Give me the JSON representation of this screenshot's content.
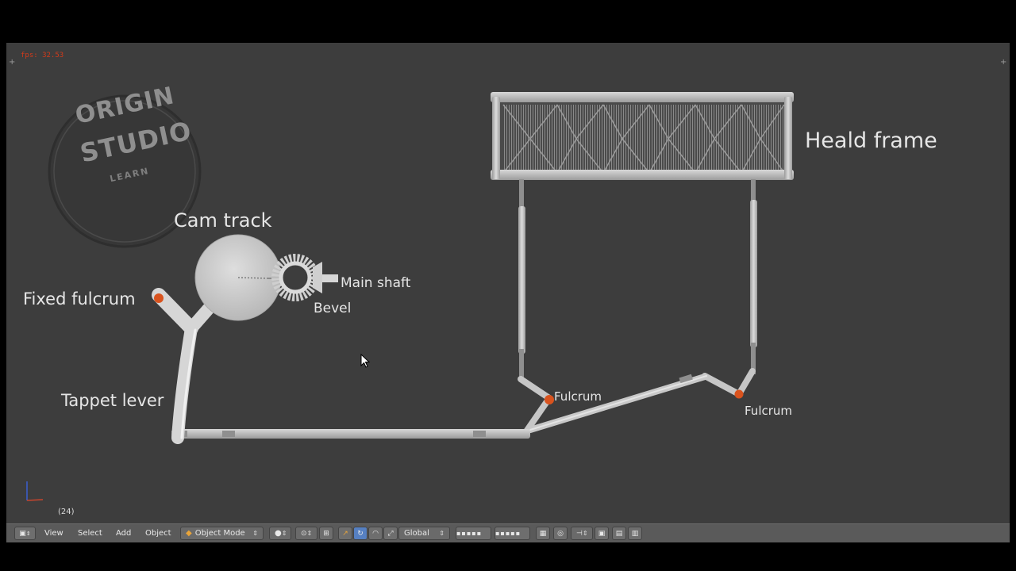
{
  "viewport": {
    "fps_text": "fps: 32.53",
    "frame_indicator": "(24)"
  },
  "watermark": {
    "line1": "ORIGIN",
    "line2": "STUDIO",
    "line3": "LEARN"
  },
  "labels": {
    "heald_frame": "Heald frame",
    "cam_track": "Cam track",
    "main_shaft": "Main shaft",
    "bevel": "Bevel",
    "fixed_fulcrum": "Fixed fulcrum",
    "tappet_lever": "Tappet lever",
    "fulcrum_left": "Fulcrum",
    "fulcrum_right": "Fulcrum"
  },
  "toolbar": {
    "view_menu": "View",
    "select_menu": "Select",
    "add_menu": "Add",
    "object_menu": "Object",
    "mode": "Object Mode",
    "orientation": "Global"
  },
  "colors": {
    "viewport_bg": "#3d3d3d",
    "pivot_orange": "#d9531e",
    "toolbar_bg": "#5a5a5a",
    "active_blue": "#5680c2"
  }
}
